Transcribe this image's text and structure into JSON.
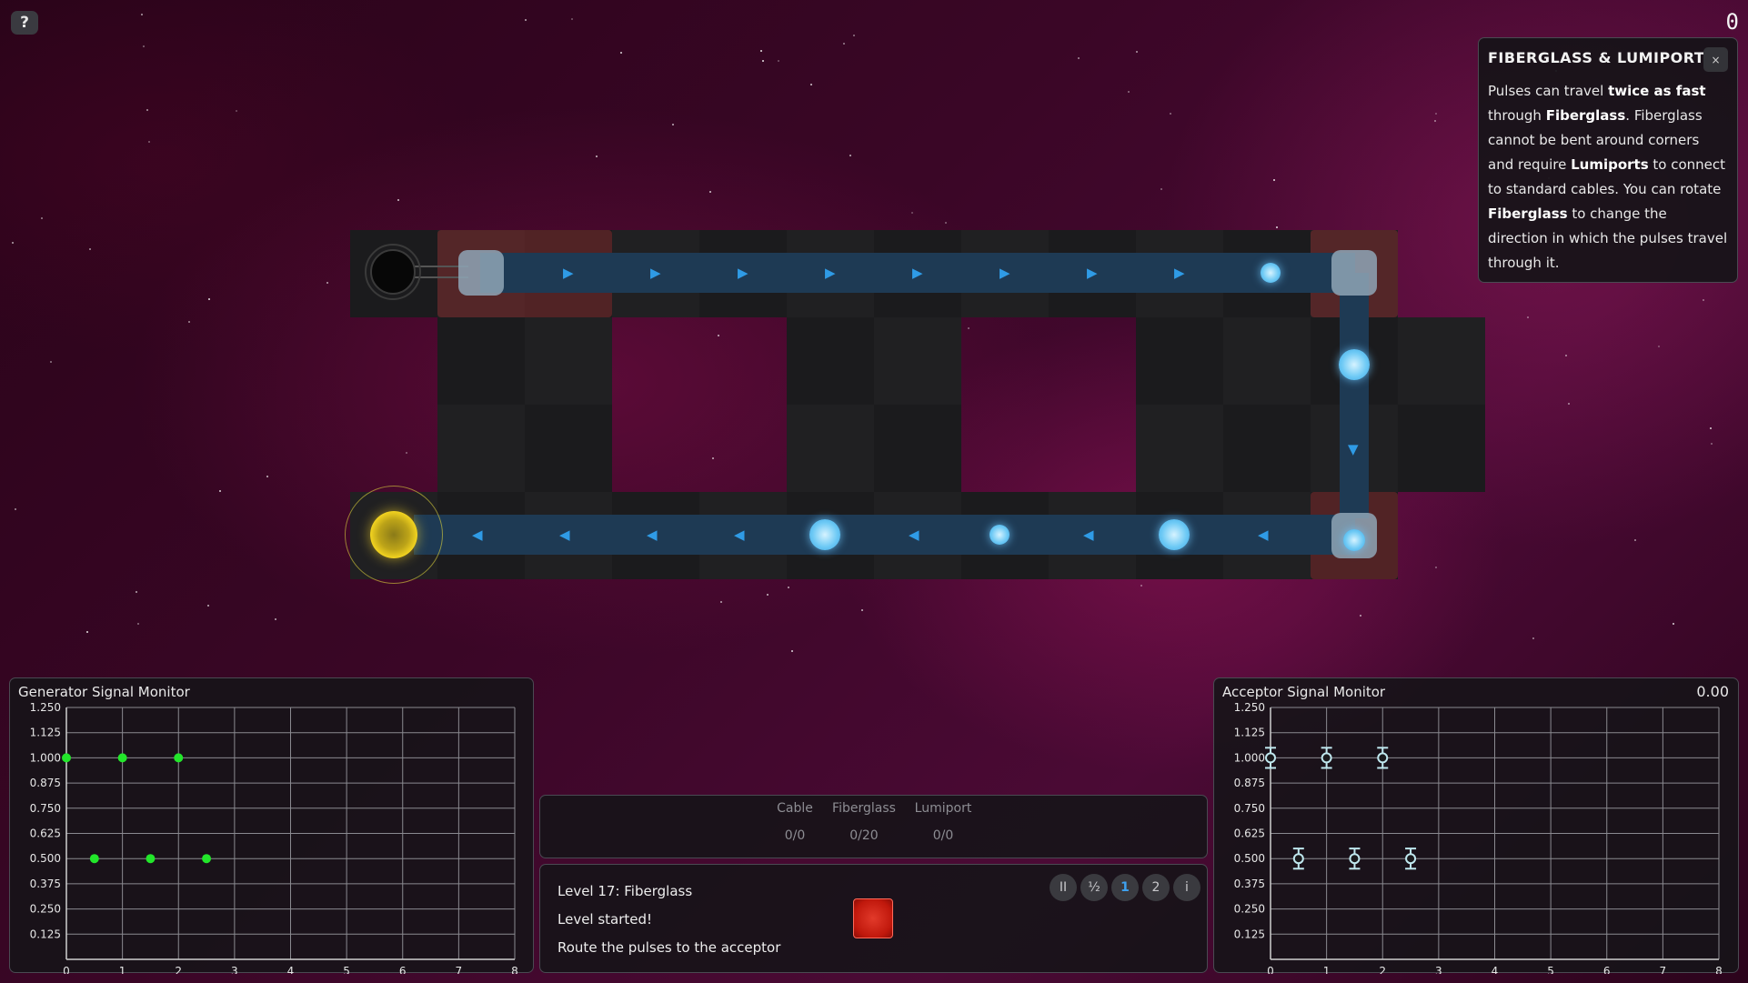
{
  "hud": {
    "help_label": "?",
    "top_counter": "0"
  },
  "tip": {
    "title": "FIBERGLASS & LUMIPORT",
    "close_label": "×",
    "segments": [
      {
        "text": "Pulses can travel ",
        "bold": false
      },
      {
        "text": "twice as fast",
        "bold": true
      },
      {
        "text": " through ",
        "bold": false
      },
      {
        "text": "Fiberglass",
        "bold": true
      },
      {
        "text": ". Fiberglass cannot be bent around corners and require ",
        "bold": false
      },
      {
        "text": "Lumiports",
        "bold": true
      },
      {
        "text": " to connect to standard cables. You can rotate ",
        "bold": false
      },
      {
        "text": "Fiberglass",
        "bold": true
      },
      {
        "text": " to change the direction in which the pulses travel through it.",
        "bold": false
      }
    ]
  },
  "generator_monitor": {
    "title": "Generator Signal Monitor",
    "chart_data": {
      "type": "scatter",
      "x_ticks": [
        "0",
        "1",
        "2",
        "3",
        "4",
        "5",
        "6",
        "7",
        "8"
      ],
      "y_ticks": [
        "0.125",
        "0.250",
        "0.375",
        "0.500",
        "0.625",
        "0.750",
        "0.875",
        "1.000",
        "1.125",
        "1.250"
      ],
      "xlim": [
        0,
        8
      ],
      "ylim": [
        0,
        1.25
      ],
      "points": [
        {
          "x": 0,
          "y": 1.0
        },
        {
          "x": 0.5,
          "y": 0.5
        },
        {
          "x": 1,
          "y": 1.0
        },
        {
          "x": 1.5,
          "y": 0.5
        },
        {
          "x": 2,
          "y": 1.0
        },
        {
          "x": 2.5,
          "y": 0.5
        }
      ],
      "point_color": "#22e62a",
      "grid": true
    }
  },
  "acceptor_monitor": {
    "title": "Acceptor Signal Monitor",
    "value": "0.00",
    "chart_data": {
      "type": "scatter",
      "x_ticks": [
        "0",
        "1",
        "2",
        "3",
        "4",
        "5",
        "6",
        "7",
        "8"
      ],
      "y_ticks": [
        "0.125",
        "0.250",
        "0.375",
        "0.500",
        "0.625",
        "0.750",
        "0.875",
        "1.000",
        "1.125",
        "1.250"
      ],
      "xlim": [
        0,
        8
      ],
      "ylim": [
        0,
        1.25
      ],
      "points": [
        {
          "x": 0,
          "y": 1.0
        },
        {
          "x": 0.5,
          "y": 0.5
        },
        {
          "x": 1,
          "y": 1.0
        },
        {
          "x": 1.5,
          "y": 0.5
        },
        {
          "x": 2,
          "y": 1.0
        },
        {
          "x": 2.5,
          "y": 0.5
        }
      ],
      "tolerance": 0.05,
      "point_color": "#bfe7ee",
      "grid": true
    }
  },
  "inventory": {
    "items": [
      {
        "label": "Cable",
        "count": "0/0"
      },
      {
        "label": "Fiberglass",
        "count": "0/20"
      },
      {
        "label": "Lumiport",
        "count": "0/0"
      }
    ]
  },
  "level": {
    "name": "Level 17: Fiberglass",
    "status": "Level started!",
    "objective": "Route the pulses to the acceptor"
  },
  "speed_controls": [
    {
      "label": "II",
      "name": "pause-button",
      "active": false
    },
    {
      "label": "½",
      "name": "half-speed-button",
      "active": false
    },
    {
      "label": "1",
      "name": "normal-speed-button",
      "active": true
    },
    {
      "label": "2",
      "name": "double-speed-button",
      "active": false
    },
    {
      "label": "i",
      "name": "info-button",
      "active": false
    }
  ],
  "colors": {
    "cable": "#1e3a54",
    "arrow": "#2f9be6",
    "pulse": "#6fcaf5",
    "lumiport_bg": "#aa3232",
    "acceptor": "#f2d320"
  }
}
